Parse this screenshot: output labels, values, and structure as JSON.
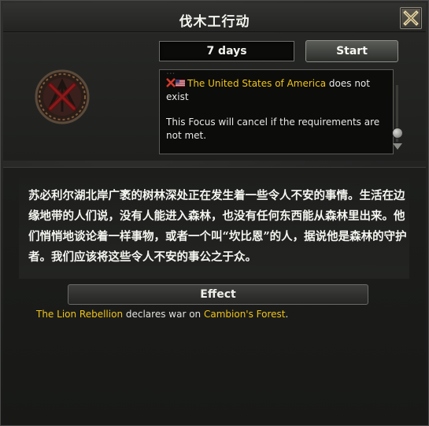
{
  "window": {
    "title": "伐木工行动"
  },
  "focus": {
    "duration": "7 days",
    "start_label": "Start",
    "icon": "forest-crossed-emblem-icon"
  },
  "requirements": {
    "hidden_previous_text": "...",
    "country": "The United States of America",
    "country_suffix": "does not exist",
    "cancel_note": "This Focus will cancel if the requirements are not met."
  },
  "description": "苏必利尔湖北岸广袤的树林深处正在发生着一些令人不安的事情。生活在边缘地带的人们说，没有人能进入森林，也没有任何东西能从森林里出来。他们悄悄地谈论着一样事物，或者一个叫“坎比恩”的人，据说他是森林的守护者。我们应该将这些令人不安的事公之于众。",
  "effect": {
    "header": "Effect",
    "actor": "The Lion Rebellion",
    "verb": "declares war on",
    "target": "Cambion's Forest",
    "end": "."
  },
  "colors": {
    "highlight": "#f0c419",
    "text": "#e9e9e6"
  }
}
